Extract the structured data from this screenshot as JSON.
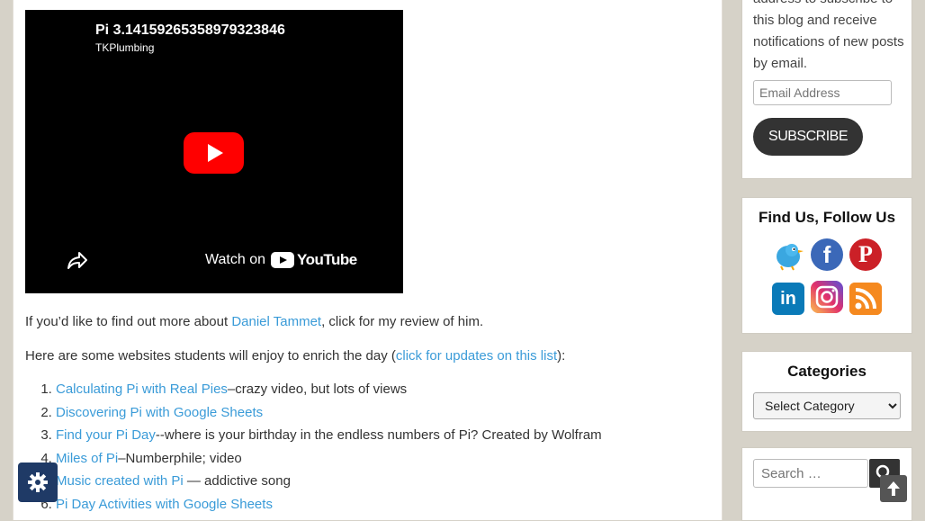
{
  "video": {
    "title": "Pi 3.14159265358979323846",
    "channel": "TKPlumbing",
    "watch_on": "Watch on",
    "youtube": "YouTube"
  },
  "intro": {
    "before": "If you’d like to find out more about ",
    "link": "Daniel Tammet",
    "after": ", click for my review of him."
  },
  "sites_intro": {
    "before": "Here are some websites students will enjoy to enrich the day (",
    "link": "click for updates on this list",
    "after": "):"
  },
  "sites": [
    {
      "link": "Calculating Pi with Real Pies",
      "text": "–crazy video, but lots of views"
    },
    {
      "link": "Discovering Pi with Google Sheets",
      "text": ""
    },
    {
      "link": "Find your Pi Day",
      "text": "--where is your birthday in the endless numbers of Pi? Created by Wolfram"
    },
    {
      "link": "Miles of Pi",
      "text": "–Numberphile; video"
    },
    {
      "link": "Music created with Pi",
      "text": " — addictive song"
    },
    {
      "link": "Pi Day Activities with Google Sheets",
      "text": ""
    }
  ],
  "subscribe": {
    "text": "address to subscribe to this blog and receive notifications of new posts by email.",
    "email_placeholder": "Email Address",
    "button": "SUBSCRIBE"
  },
  "follow": {
    "title": "Find Us, Follow Us",
    "icons": [
      "twitter-icon",
      "facebook-icon",
      "pinterest-icon",
      "linkedin-icon",
      "instagram-icon",
      "rss-icon"
    ]
  },
  "categories": {
    "title": "Categories",
    "selected": "Select Category"
  },
  "search": {
    "placeholder": "Search …"
  },
  "colors": {
    "link": "#3a9bd8",
    "button_dark": "#333333",
    "settings_button": "#1f3a66",
    "youtube_red": "#ff0000"
  }
}
